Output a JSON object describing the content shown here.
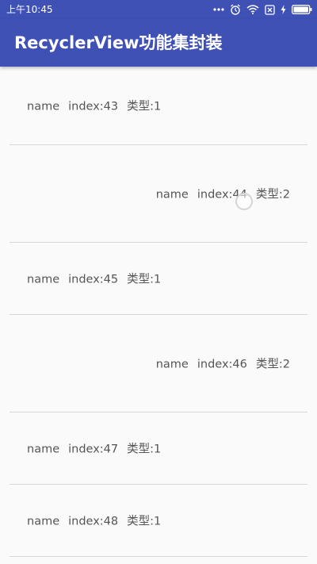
{
  "status_bar": {
    "time": "上午10:45",
    "icons": [
      "more-dots-icon",
      "alarm-icon",
      "wifi-icon",
      "sim-x-icon",
      "charging-icon",
      "battery-icon"
    ]
  },
  "toolbar": {
    "title": "RecyclerView功能集封装",
    "color": "#3f51b5"
  },
  "list": {
    "items": [
      {
        "name": "name",
        "index": "index:43",
        "type": "类型:1"
      },
      {
        "name": "name",
        "index": "index:44",
        "type": "类型:2"
      },
      {
        "name": "name",
        "index": "index:45",
        "type": "类型:1"
      },
      {
        "name": "name",
        "index": "index:46",
        "type": "类型:2"
      },
      {
        "name": "name",
        "index": "index:47",
        "type": "类型:1"
      },
      {
        "name": "name",
        "index": "index:48",
        "type": "类型:1"
      }
    ]
  }
}
